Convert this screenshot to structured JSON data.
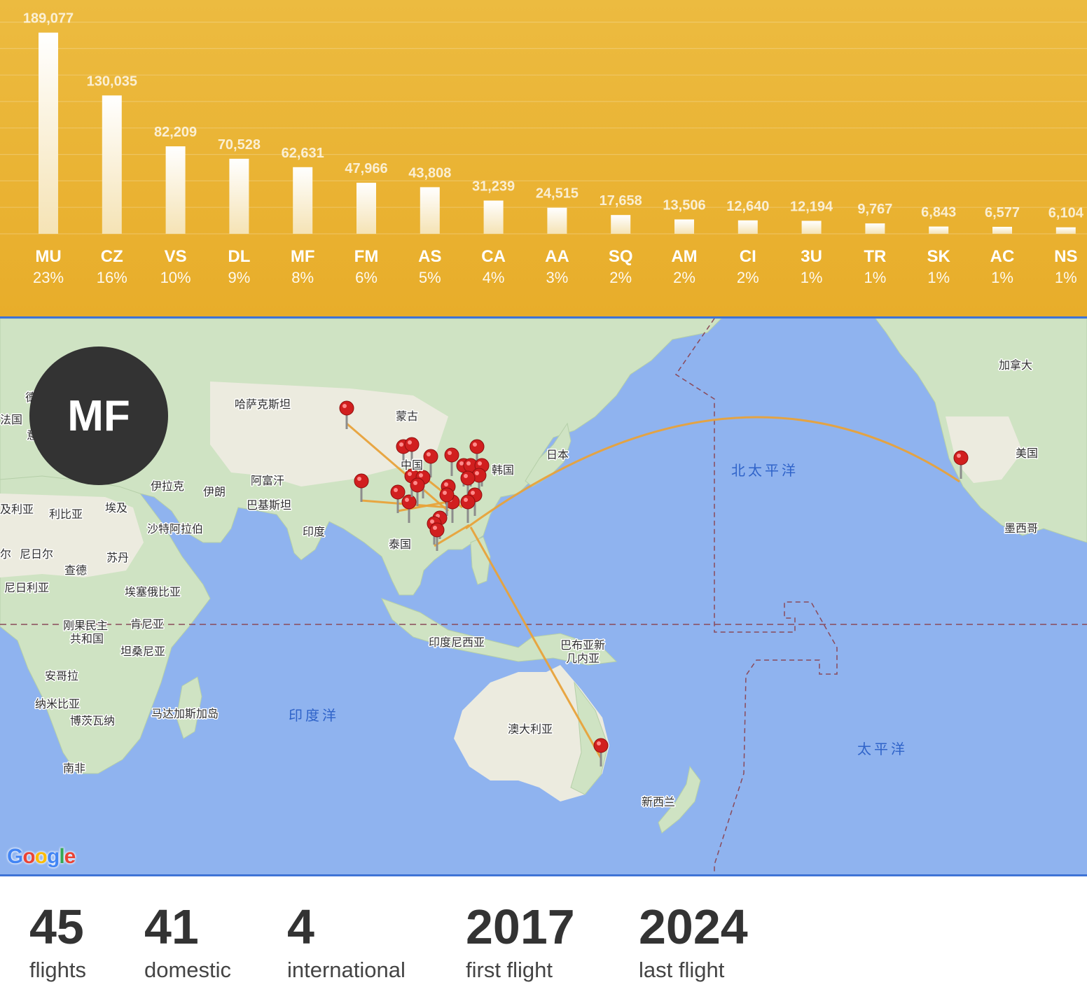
{
  "chart_data": {
    "type": "bar",
    "categories": [
      "MU",
      "CZ",
      "VS",
      "DL",
      "MF",
      "FM",
      "AS",
      "CA",
      "AA",
      "SQ",
      "AM",
      "CI",
      "3U",
      "TR",
      "SK",
      "AC",
      "NS"
    ],
    "values": [
      189077,
      130035,
      82209,
      70528,
      62631,
      47966,
      43808,
      31239,
      24515,
      17658,
      13506,
      12640,
      12194,
      9767,
      6843,
      6577,
      6104
    ],
    "value_labels": [
      "189,077",
      "130,035",
      "82,209",
      "70,528",
      "62,631",
      "47,966",
      "43,808",
      "31,239",
      "24,515",
      "17,658",
      "13,506",
      "12,640",
      "12,194",
      "9,767",
      "6,843",
      "6,577",
      "6,104"
    ],
    "percentages": [
      "23%",
      "16%",
      "10%",
      "9%",
      "8%",
      "6%",
      "5%",
      "4%",
      "3%",
      "2%",
      "2%",
      "2%",
      "1%",
      "1%",
      "1%",
      "1%",
      "1%"
    ],
    "ylim": [
      0,
      200000
    ],
    "grid": true,
    "colors": {
      "bar_top": "#ffffff",
      "bar_bottom": "#f5e3b5",
      "background": "#eab535"
    }
  },
  "map": {
    "badge": "MF",
    "provider_logo": "Google",
    "labels": {
      "kazakhstan": "哈萨克斯坦",
      "mongolia": "蒙古",
      "china": "中国",
      "korea": "韩国",
      "japan": "日本",
      "iraq": "伊拉克",
      "iran": "伊朗",
      "afghanistan": "阿富汗",
      "pakistan": "巴基斯坦",
      "india": "印度",
      "thailand": "泰国",
      "saudi_arabia": "沙特阿拉伯",
      "egypt": "埃及",
      "libya": "利比亚",
      "algeria": "及利亚",
      "niger": "尼日尔",
      "chad": "查德",
      "sudan": "苏丹",
      "nigeria": "尼日利亚",
      "ethiopia": "埃塞俄比亚",
      "drc_1": "刚果民主",
      "drc_2": "共和国",
      "kenya": "肯尼亚",
      "tanzania": "坦桑尼亚",
      "angola": "安哥拉",
      "namibia": "纳米比亚",
      "botswana": "博茨瓦纳",
      "madagascar": "马达加斯加岛",
      "south_africa": "南非",
      "france": "法国",
      "germany": "德",
      "italy": "意",
      "mali": "尔",
      "indonesia": "印度尼西亚",
      "png_1": "巴布亚新",
      "png_2": "几内亚",
      "australia": "澳大利亚",
      "new_zealand": "新西兰",
      "canada": "加拿大",
      "usa": "美国",
      "mexico": "墨西哥",
      "north_pacific": "北太平洋",
      "pacific": "太平洋",
      "indian_ocean": "印度洋"
    }
  },
  "stats": [
    {
      "value": "45",
      "label": "flights"
    },
    {
      "value": "41",
      "label": "domestic"
    },
    {
      "value": "4",
      "label": "international"
    },
    {
      "value": "2017",
      "label": "first flight"
    },
    {
      "value": "2024",
      "label": "last flight"
    }
  ]
}
